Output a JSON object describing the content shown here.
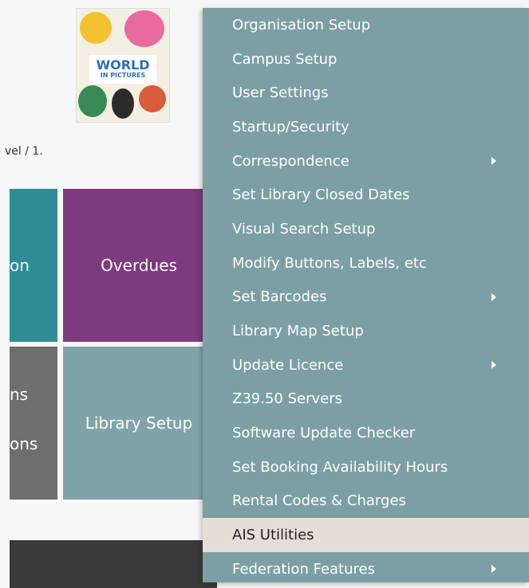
{
  "book": {
    "title_main": "WORLD",
    "title_sub": "IN PICTURES"
  },
  "breadcrumb": "vel / 1.",
  "tiles": {
    "left_top": "on",
    "overdues": "Overdues",
    "left_bottom_1": "ns",
    "left_bottom_2": "ons",
    "library_setup": "Library Setup"
  },
  "menu": {
    "items": [
      {
        "label": "Organisation Setup",
        "submenu": false
      },
      {
        "label": "Campus Setup",
        "submenu": false
      },
      {
        "label": "User Settings",
        "submenu": false
      },
      {
        "label": "Startup/Security",
        "submenu": false
      },
      {
        "label": "Correspondence",
        "submenu": true
      },
      {
        "label": "Set Library Closed Dates",
        "submenu": false
      },
      {
        "label": "Visual Search Setup",
        "submenu": false
      },
      {
        "label": "Modify Buttons, Labels, etc",
        "submenu": false
      },
      {
        "label": "Set Barcodes",
        "submenu": true
      },
      {
        "label": "Library Map Setup",
        "submenu": false
      },
      {
        "label": "Update Licence",
        "submenu": true
      },
      {
        "label": "Z39.50 Servers",
        "submenu": false
      },
      {
        "label": "Software Update Checker",
        "submenu": false
      },
      {
        "label": "Set Booking Availability Hours",
        "submenu": false
      },
      {
        "label": "Rental Codes & Charges",
        "submenu": false
      },
      {
        "label": "AIS Utilities",
        "submenu": false,
        "highlighted": true
      },
      {
        "label": "Federation Features",
        "submenu": true
      }
    ]
  },
  "colors": {
    "menu_bg": "#7c9fa4",
    "menu_highlight": "#e3dfd6",
    "overdues_tile": "#7e3a7e",
    "teal_tile": "#2e8c97",
    "library_setup_tile": "#7fa4a8"
  }
}
